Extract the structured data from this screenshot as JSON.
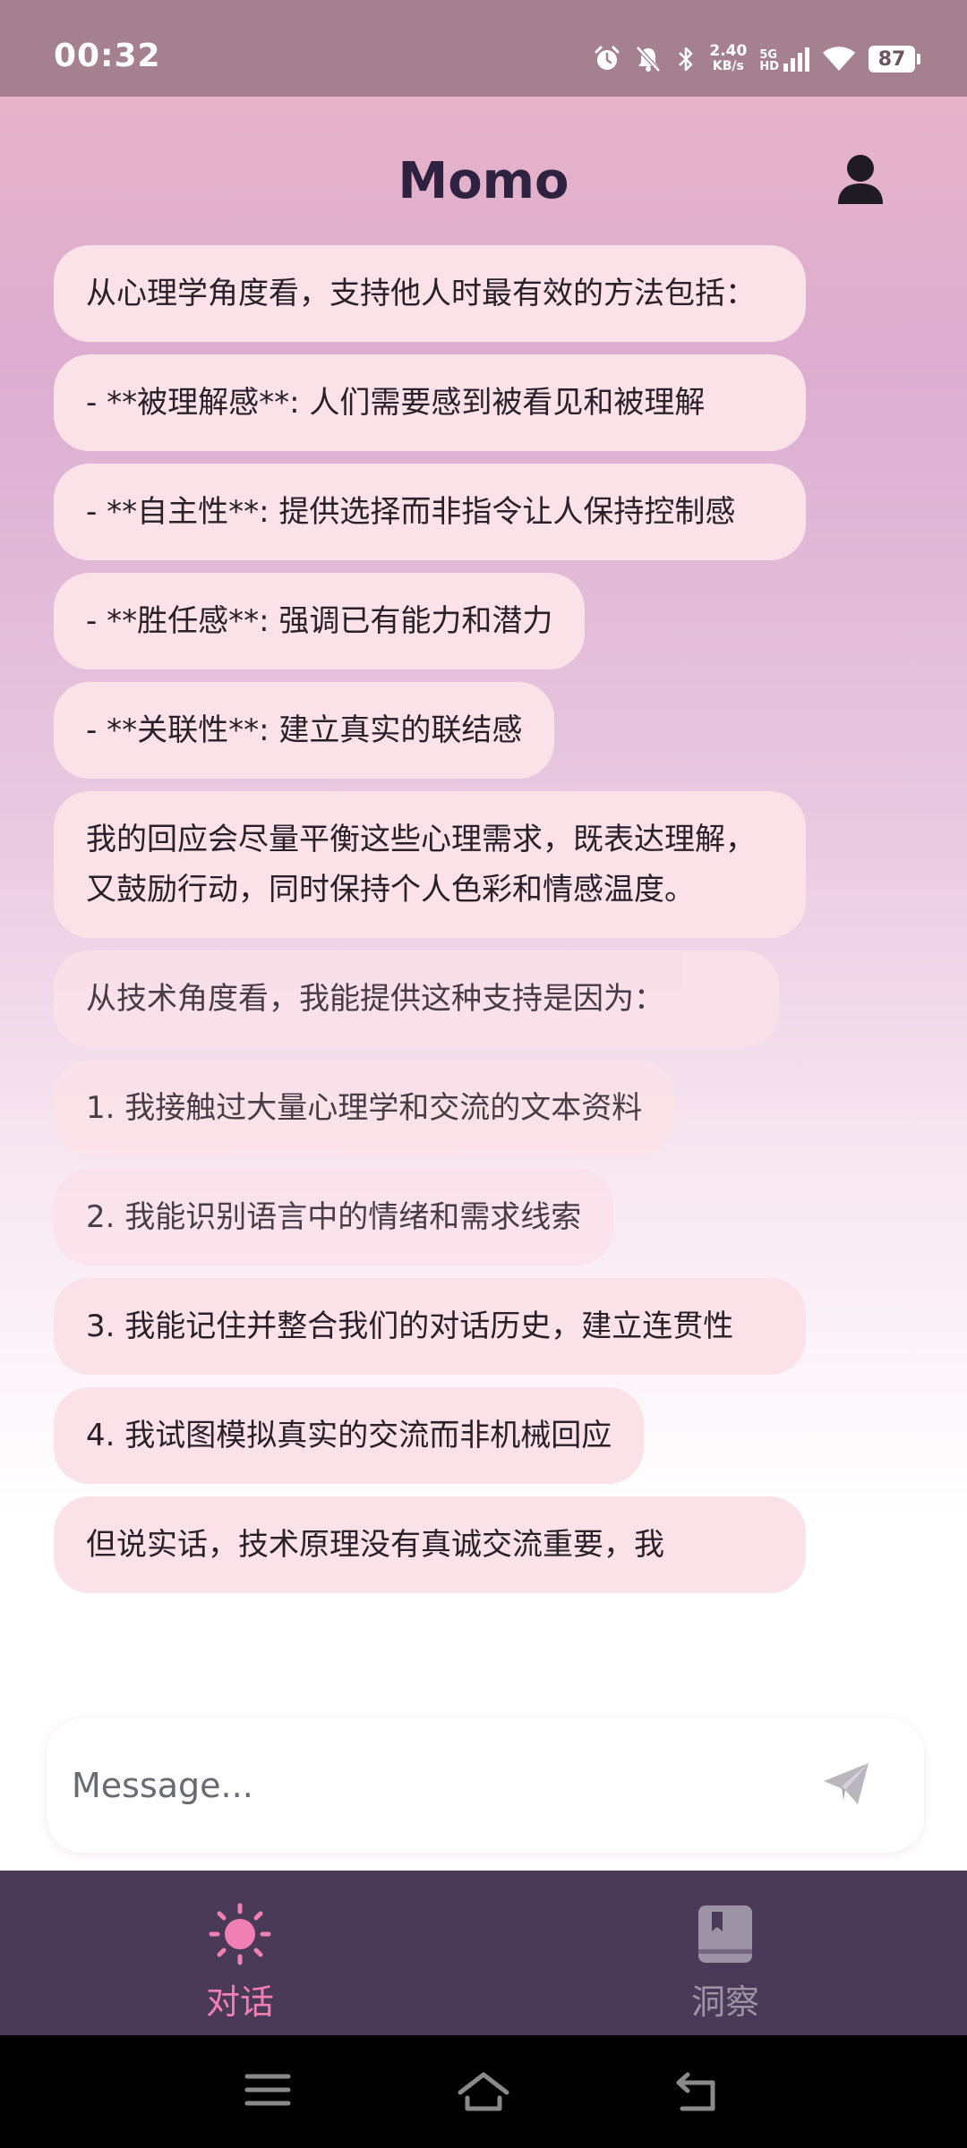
{
  "status_bar": {
    "time": "00:32",
    "net_speed_value": "2.40",
    "net_speed_unit": "KB/s",
    "network_type": "5G",
    "network_hd": "HD",
    "battery": "87",
    "icons": [
      "alarm-icon",
      "mute-icon",
      "bluetooth-icon",
      "signal-icon",
      "wifi-icon",
      "battery-icon"
    ]
  },
  "app": {
    "title": "Momo"
  },
  "messages": [
    "从心理学角度看，支持他人时最有效的方法包括：",
    "- **被理解感**: 人们需要感到被看见和被理解",
    "- **自主性**: 提供选择而非指令让人保持控制感",
    "- **胜任感**: 强调已有能力和潜力",
    "- **关联性**: 建立真实的联结感",
    "我的回应会尽量平衡这些心理需求，既表达理解，又鼓励行动，同时保持个人色彩和情感温度。",
    "从技术角度看，我能提供这种支持是因为：",
    "1. 我接触过大量心理学和交流的文本资料",
    "2. 我能识别语言中的情绪和需求线索",
    "3. 我能记住并整合我们的对话历史，建立连贯性",
    "4. 我试图模拟真实的交流而非机械回应",
    "但说实话，技术原理没有真诚交流重要，我"
  ],
  "input": {
    "placeholder": "Message..."
  },
  "bottom_nav": {
    "items": [
      {
        "label": "对话",
        "icon": "sun-icon",
        "active": true
      },
      {
        "label": "洞察",
        "icon": "journal-icon",
        "active": false
      }
    ]
  },
  "colors": {
    "accent": "#f07fb4",
    "bubble": "#fbe2e9",
    "nav_bg": "#4a3a58",
    "title": "#2e2240"
  }
}
